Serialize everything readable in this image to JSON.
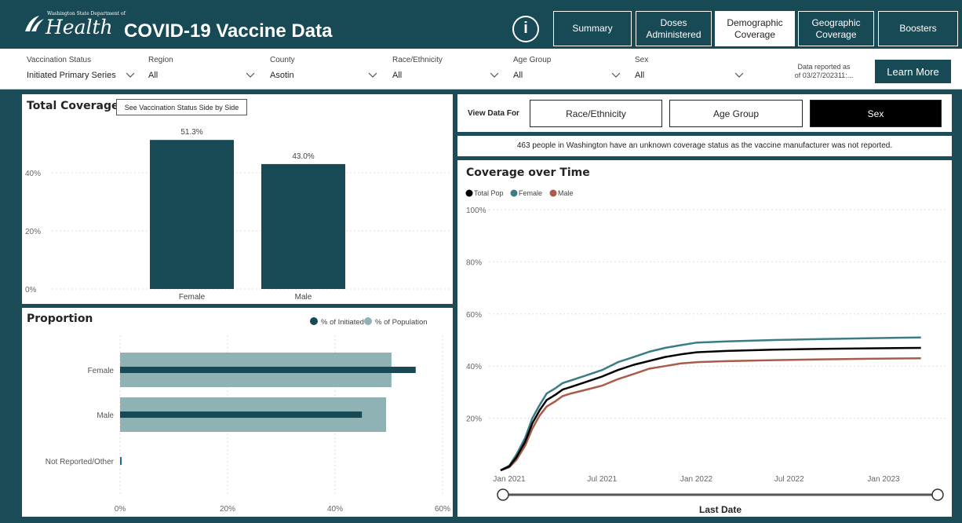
{
  "header": {
    "logo_small": "Washington State Department of",
    "logo_big": "Health",
    "title": "COVID-19 Vaccine Data",
    "info_icon_text": "i",
    "nav": [
      {
        "label": "Summary",
        "active": false
      },
      {
        "label": "Doses Administered",
        "active": false
      },
      {
        "label": "Demographic Coverage",
        "active": true
      },
      {
        "label": "Geographic Coverage",
        "active": false
      },
      {
        "label": "Boosters",
        "active": false
      }
    ]
  },
  "filters": [
    {
      "label": "Vaccination Status",
      "value": "Initiated Primary Series"
    },
    {
      "label": "Region",
      "value": "All"
    },
    {
      "label": "County",
      "value": "Asotin"
    },
    {
      "label": "Race/Ethnicity",
      "value": "All"
    },
    {
      "label": "Age Group",
      "value": "All"
    },
    {
      "label": "Sex",
      "value": "All"
    }
  ],
  "reported": {
    "line1": "Data reported as",
    "line2": "of 03/27/202311:..."
  },
  "learn_more": "Learn More",
  "total_coverage": {
    "title": "Total Coverage",
    "side_by_side_button": "See Vaccination Status Side by Side"
  },
  "proportion": {
    "title": "Proportion"
  },
  "view_data": {
    "label": "View Data For",
    "options": [
      "Race/Ethnicity",
      "Age Group",
      "Sex"
    ],
    "selected": "Sex"
  },
  "notice": "463 people in Washington have an unknown coverage status as the vaccine manufacturer was not reported.",
  "coverage_time": {
    "title": "Coverage over Time",
    "slider_label": "Last Date"
  },
  "colors": {
    "teal": "#174a55",
    "light_teal": "#8fb3b5",
    "female": "#3a7d85",
    "male": "#a95c4c",
    "total": "#000000"
  },
  "chart_data": [
    {
      "type": "bar",
      "title": "Total Coverage",
      "categories": [
        "Female",
        "Male"
      ],
      "values": [
        51.3,
        43.0
      ],
      "data_labels": [
        "51.3%",
        "43.0%"
      ],
      "y_ticks": [
        "0%",
        "20%",
        "40%"
      ],
      "ylim": [
        0,
        55
      ]
    },
    {
      "type": "bar",
      "title": "Proportion",
      "orientation": "horizontal",
      "categories": [
        "Female",
        "Male",
        "Not Reported/Other"
      ],
      "series": [
        {
          "name": "% of Initiated",
          "values": [
            55,
            45,
            0.2
          ]
        },
        {
          "name": "% of Population",
          "values": [
            50.5,
            49.5,
            0
          ]
        }
      ],
      "x_ticks": [
        "0%",
        "20%",
        "40%",
        "60%"
      ],
      "xlim": [
        0,
        60
      ],
      "legend": "top-right"
    },
    {
      "type": "line",
      "title": "Coverage over Time",
      "x_ticks": [
        "Jan 2021",
        "Jul 2021",
        "Jan 2022",
        "Jul 2022",
        "Jan 2023"
      ],
      "y_ticks": [
        "20%",
        "40%",
        "60%",
        "80%",
        "100%"
      ],
      "ylim": [
        0,
        100
      ],
      "x": [
        "2020-12-15",
        "2021-01-01",
        "2021-01-15",
        "2021-02-01",
        "2021-02-15",
        "2021-03-01",
        "2021-03-15",
        "2021-04-01",
        "2021-04-15",
        "2021-05-01",
        "2021-06-01",
        "2021-07-01",
        "2021-08-01",
        "2021-09-01",
        "2021-10-01",
        "2021-11-01",
        "2021-12-01",
        "2022-01-01",
        "2022-03-01",
        "2022-06-01",
        "2022-09-01",
        "2022-12-01",
        "2023-03-15"
      ],
      "series": [
        {
          "name": "Total Pop",
          "values": [
            0,
            1.5,
            5,
            11,
            18,
            23,
            27,
            29,
            31,
            32,
            34,
            36,
            38.5,
            40.5,
            42,
            43.5,
            44.5,
            45.3,
            45.8,
            46.3,
            46.6,
            46.8,
            47
          ]
        },
        {
          "name": "Female",
          "values": [
            0,
            1.8,
            6,
            12.5,
            20,
            25,
            29.5,
            31.5,
            33.5,
            34.5,
            36.5,
            38.5,
            41.5,
            43.5,
            45.5,
            47,
            48,
            49,
            49.5,
            50,
            50.4,
            50.7,
            51
          ]
        },
        {
          "name": "Male",
          "values": [
            0,
            1.2,
            4,
            9.5,
            16,
            21,
            24.5,
            26.5,
            28.5,
            29.5,
            31,
            32.5,
            35,
            37,
            39,
            40,
            41,
            41.5,
            41.9,
            42.3,
            42.6,
            42.8,
            43
          ]
        }
      ],
      "legend": "top-left"
    }
  ]
}
